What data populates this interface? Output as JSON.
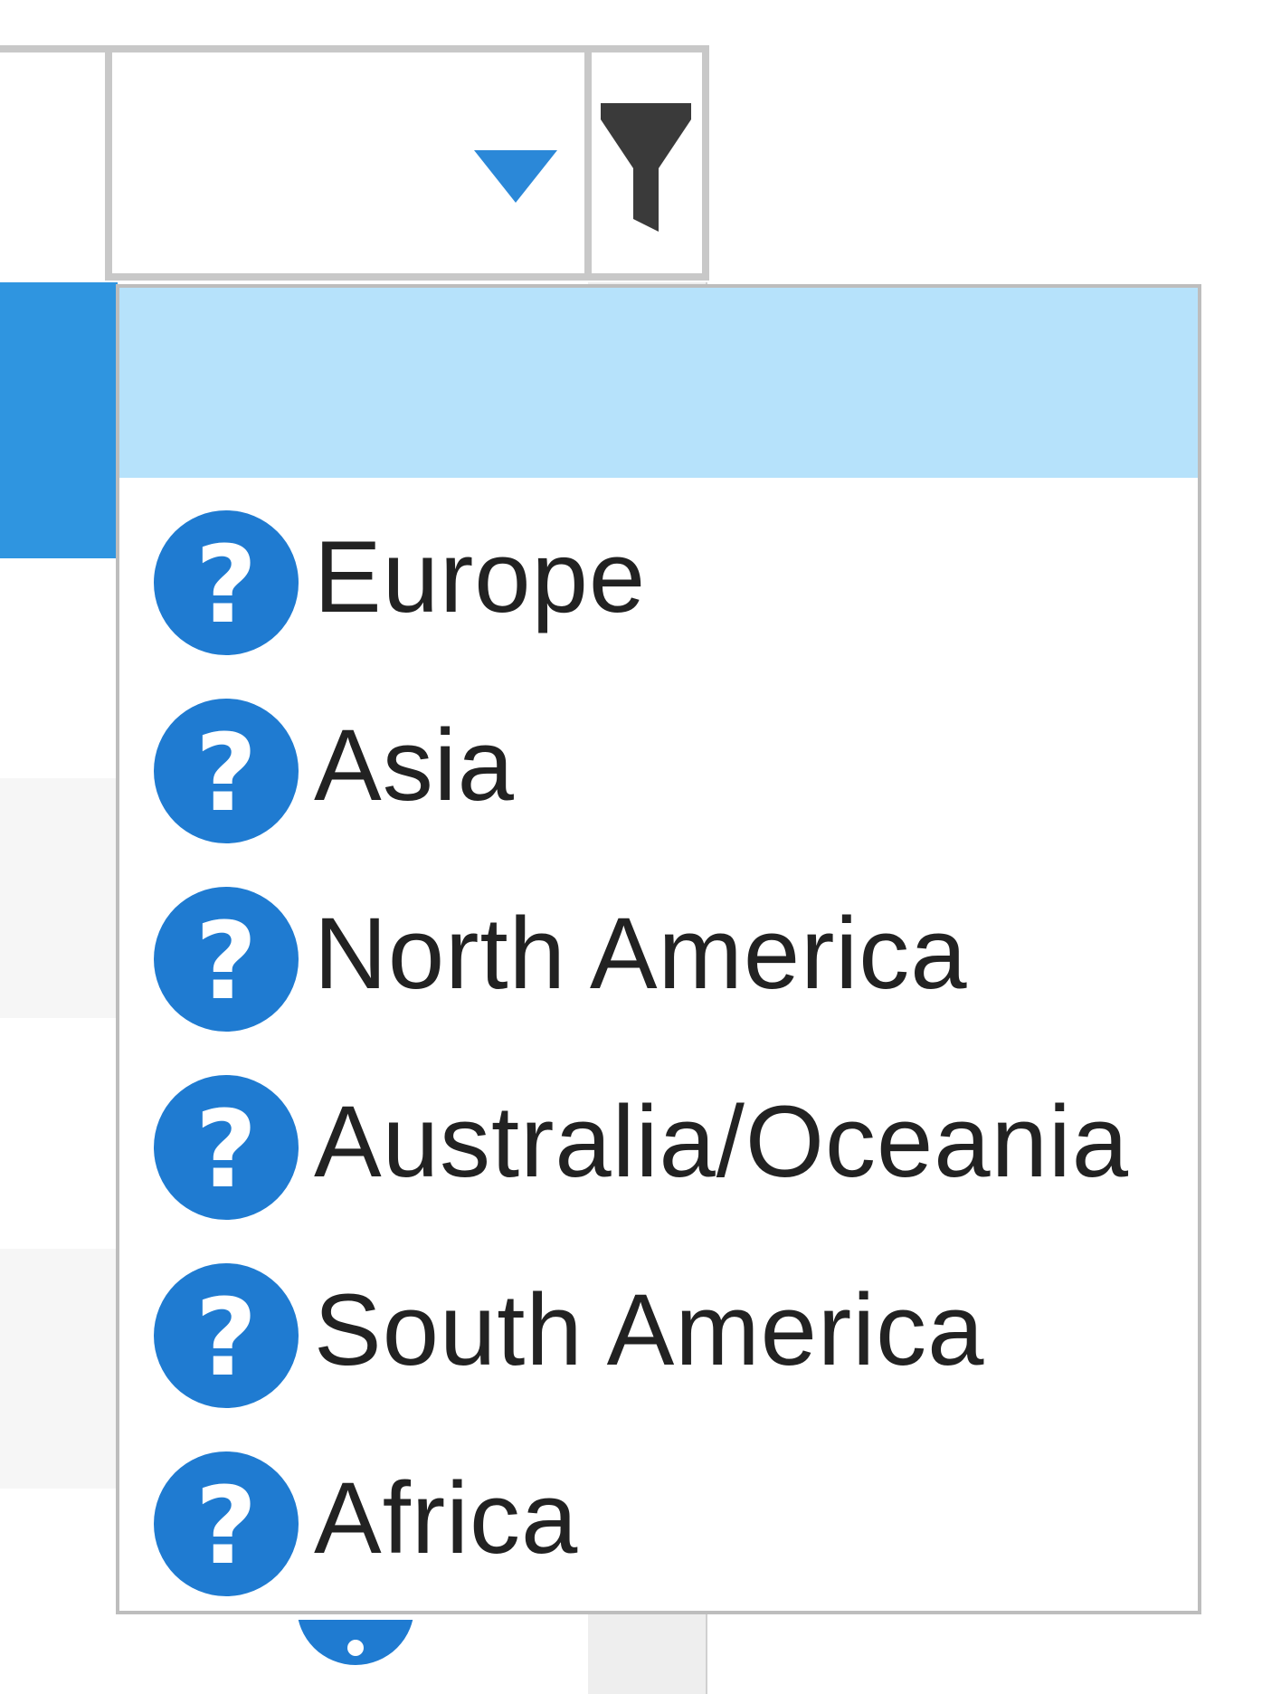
{
  "select": {
    "value": "",
    "options": [
      {
        "label": ""
      },
      {
        "label": "Europe"
      },
      {
        "label": "Asia"
      },
      {
        "label": "North America"
      },
      {
        "label": "Australia/Oceania"
      },
      {
        "label": "South America"
      },
      {
        "label": "Africa"
      }
    ],
    "selected_index": 0
  },
  "icons": {
    "dropdown_arrow": "chevron-down-icon",
    "filter": "filter-icon",
    "item_icon": "question-icon",
    "item_icon_glyph": "?"
  },
  "colors": {
    "accent": "#2b88d8",
    "icon_blue": "#1f7bd1",
    "highlight": "#b6e2fb",
    "border": "#c8c8c8",
    "filter_icon": "#3a3a3a"
  }
}
